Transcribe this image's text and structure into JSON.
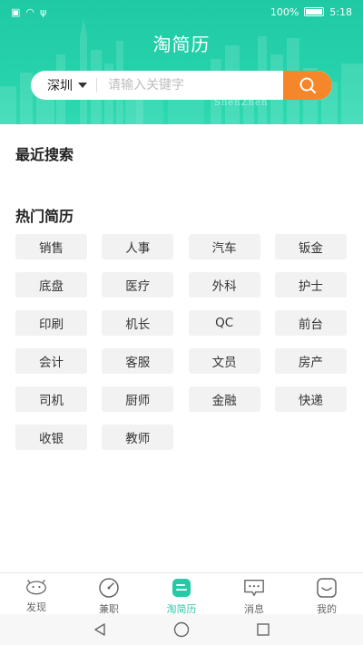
{
  "status_bar": {
    "battery_percent": "100%",
    "time": "5:18"
  },
  "header": {
    "title": "淘简历",
    "watermark": "ShenZhen"
  },
  "search": {
    "city": "深圳",
    "placeholder": "请输入关键字",
    "button_color": "#f5862a"
  },
  "recent": {
    "title": "最近搜索"
  },
  "hot": {
    "title": "热门简历",
    "tags": [
      "销售",
      "人事",
      "汽车",
      "钣金",
      "底盘",
      "医疗",
      "外科",
      "护士",
      "印刷",
      "机长",
      "QC",
      "前台",
      "会计",
      "客服",
      "文员",
      "房产",
      "司机",
      "厨师",
      "金融",
      "快递",
      "收银",
      "教师"
    ]
  },
  "tabbar": {
    "items": [
      {
        "label": "发现",
        "icon": "discover-icon"
      },
      {
        "label": "兼职",
        "icon": "gauge-icon"
      },
      {
        "label": "淘简历",
        "icon": "resume-icon",
        "active": true
      },
      {
        "label": "消息",
        "icon": "message-icon"
      },
      {
        "label": "我的",
        "icon": "profile-icon"
      }
    ],
    "active_color": "#26c9a6"
  },
  "theme": {
    "primary": "#26d2ab",
    "accent": "#f5862a"
  }
}
